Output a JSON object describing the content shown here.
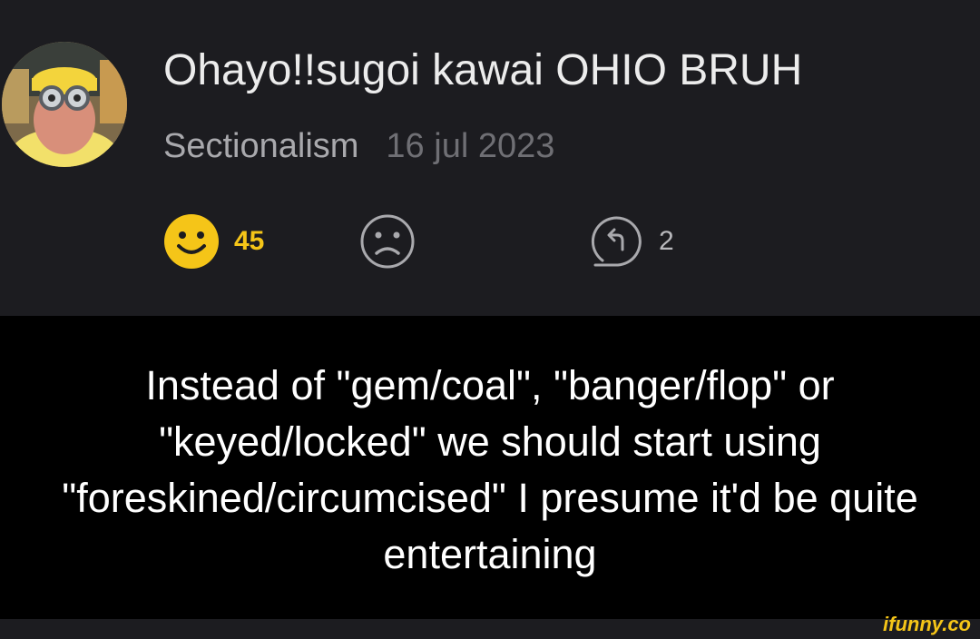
{
  "comment": {
    "username": "Ohayo!!sugoi kawai OHIO BRUH",
    "community": "Sectionalism",
    "date": "16 jul 2023",
    "smile_count": "45",
    "reply_count": "2"
  },
  "post": {
    "text": "Instead of \"gem/coal\", \"banger/flop\" or \"keyed/locked\" we should start using \"foreskined/circumcised\" I presume it'd be quite entertaining"
  },
  "watermark": "ifunny.co",
  "colors": {
    "background": "#1c1c20",
    "post_background": "#000000",
    "smile_accent": "#f5c518",
    "muted_text": "#a9a9ad",
    "watermark": "#f5c518"
  },
  "icons": [
    "smile-icon",
    "frown-icon",
    "reply-icon"
  ]
}
